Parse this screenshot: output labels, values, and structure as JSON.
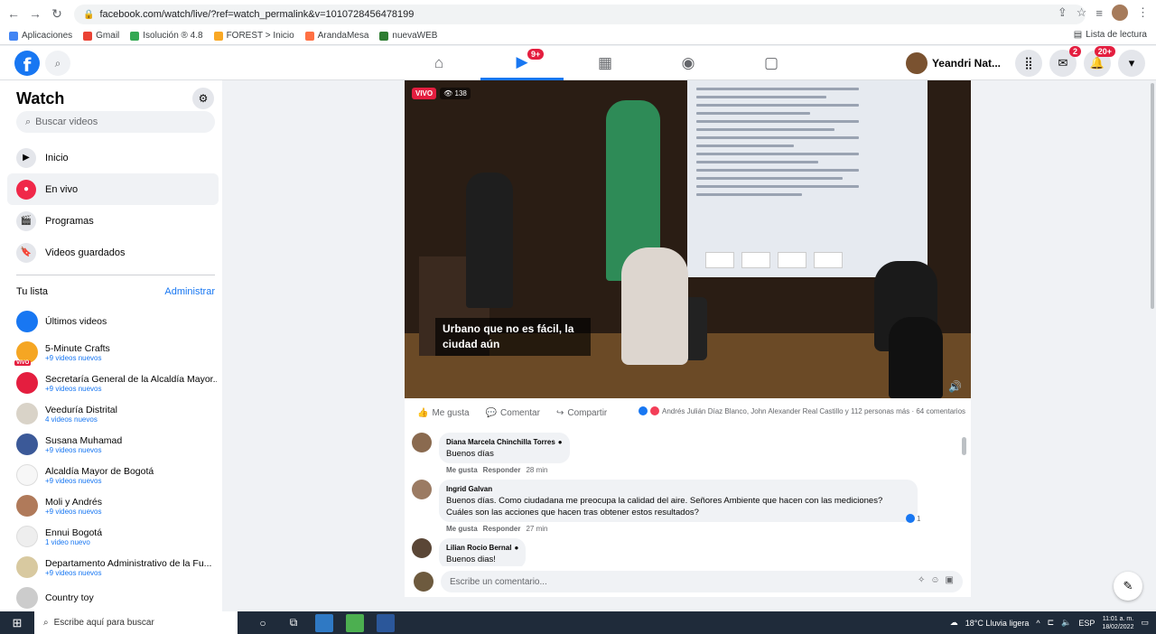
{
  "browser": {
    "url": "facebook.com/watch/live/?ref=watch_permalink&v=1010728456478199",
    "bookmarks": [
      "Aplicaciones",
      "Gmail",
      "Isolución ® 4.8",
      "FOREST > Inicio",
      "ArandaMesa",
      "nuevaWEB"
    ],
    "reading_list": "Lista de lectura"
  },
  "fb_header": {
    "logo": "f",
    "video_badge": "9+",
    "user_name": "Yeandri Nat...",
    "messenger_badge": "2",
    "notifications_badge": "20+"
  },
  "sidebar": {
    "title": "Watch",
    "search_placeholder": "Buscar videos",
    "menu": [
      {
        "label": "Inicio"
      },
      {
        "label": "En vivo"
      },
      {
        "label": "Programas"
      },
      {
        "label": "Videos guardados"
      }
    ],
    "list_title": "Tu lista",
    "admin_label": "Administrar",
    "list": [
      {
        "name": "Últimos videos",
        "sub": "",
        "color": "#1877f2"
      },
      {
        "name": "5-Minute Crafts",
        "sub": "+9 videos nuevos",
        "color": "#f5a623"
      },
      {
        "name": "Secretaría General de la Alcaldía Mayor...",
        "sub": "+9 videos nuevos",
        "color": "#e41e3f"
      },
      {
        "name": "Veeduría Distrital",
        "sub": "4 videos nuevos",
        "color": "#d9d3c8"
      },
      {
        "name": "Susana Muhamad",
        "sub": "+9 videos nuevos",
        "color": "#3b5998"
      },
      {
        "name": "Alcaldía Mayor de Bogotá",
        "sub": "+9 videos nuevos",
        "color": "#f7f7f7"
      },
      {
        "name": "Moli y Andrés",
        "sub": "+9 videos nuevos",
        "color": "#b07a5a"
      },
      {
        "name": "Ennui Bogotá",
        "sub": "1 video nuevo",
        "color": "#eeeeee"
      },
      {
        "name": "Departamento Administrativo de la Fu...",
        "sub": "+9 videos nuevos",
        "color": "#d8c9a0"
      },
      {
        "name": "Country toy",
        "sub": "",
        "color": "#cccccc"
      }
    ],
    "vivo_tag": "VIVO"
  },
  "video": {
    "live_label": "VIVO",
    "viewers": "138",
    "caption": "Urbano que no es fácil, la ciudad aún"
  },
  "actions": {
    "like": "Me gusta",
    "comment": "Comentar",
    "share": "Compartir",
    "summary": "Andrés Julián Díaz Blanco, John Alexander Real Castillo y 112 personas más · 64 comentarios"
  },
  "comments": [
    {
      "author": "Diana Marcela Chinchilla Torres",
      "text": "Buenos días",
      "like": "Me gusta",
      "reply": "Responder",
      "time": "28 min",
      "color": "#8a6a4f"
    },
    {
      "author": "Ingrid Galvan",
      "text": "Buenos días. Como ciudadana me preocupa la calidad del aire. Señores Ambiente que hacen con las mediciones? Cuáles son las acciones que hacen tras obtener estos resultados?",
      "like": "Me gusta",
      "reply": "Responder",
      "time": "27 min",
      "color": "#9b7b63"
    },
    {
      "author": "Lilian Rocio Bernal",
      "text": "Buenos dias!",
      "like": "",
      "reply": "",
      "time": "",
      "color": "#5a4636"
    }
  ],
  "comment_reaction_count": "1",
  "compose_placeholder": "Escribe un comentario...",
  "taskbar": {
    "search_placeholder": "Escribe aquí para buscar",
    "weather": "18°C Lluvia ligera",
    "lang": "ESP",
    "time": "11:01 a. m.",
    "date": "18/02/2022"
  }
}
